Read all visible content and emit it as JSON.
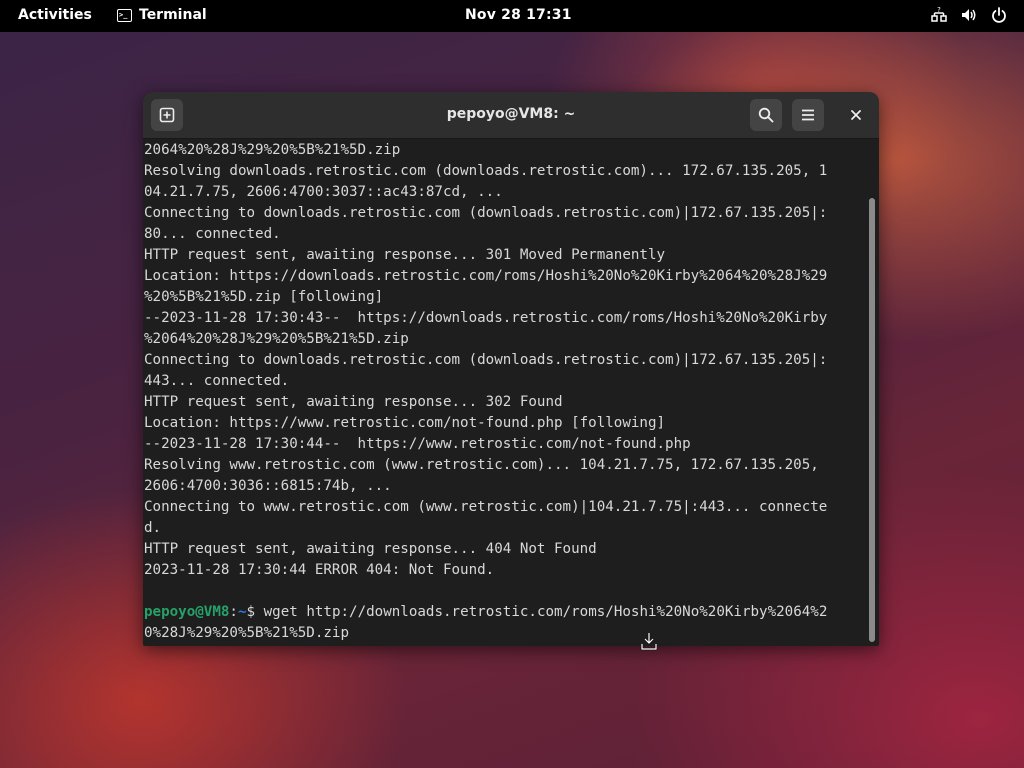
{
  "topbar": {
    "activities": "Activities",
    "app_name": "Terminal",
    "app_icon": "terminal-icon",
    "clock": "Nov 28  17:31",
    "system_icons": [
      "accessibility-icon",
      "volume-icon",
      "power-icon"
    ]
  },
  "window": {
    "title": "pepoyo@VM8: ~",
    "new_tab_icon": "new-tab-icon",
    "search_icon": "search-icon",
    "menu_icon": "hamburger-menu-icon",
    "close_icon": "close-icon"
  },
  "terminal": {
    "lines": [
      "2064%20%28J%29%20%5B%21%5D.zip",
      "Resolving downloads.retrostic.com (downloads.retrostic.com)... 172.67.135.205, 1",
      "04.21.7.75, 2606:4700:3037::ac43:87cd, ...",
      "Connecting to downloads.retrostic.com (downloads.retrostic.com)|172.67.135.205|:",
      "80... connected.",
      "HTTP request sent, awaiting response... 301 Moved Permanently",
      "Location: https://downloads.retrostic.com/roms/Hoshi%20No%20Kirby%2064%20%28J%29",
      "%20%5B%21%5D.zip [following]",
      "--2023-11-28 17:30:43--  https://downloads.retrostic.com/roms/Hoshi%20No%20Kirby",
      "%2064%20%28J%29%20%5B%21%5D.zip",
      "Connecting to downloads.retrostic.com (downloads.retrostic.com)|172.67.135.205|:",
      "443... connected.",
      "HTTP request sent, awaiting response... 302 Found",
      "Location: https://www.retrostic.com/not-found.php [following]",
      "--2023-11-28 17:30:44--  https://www.retrostic.com/not-found.php",
      "Resolving www.retrostic.com (www.retrostic.com)... 104.21.7.75, 172.67.135.205,",
      "2606:4700:3036::6815:74b, ...",
      "Connecting to www.retrostic.com (www.retrostic.com)|104.21.7.75|:443... connecte",
      "d.",
      "HTTP request sent, awaiting response... 404 Not Found",
      "2023-11-28 17:30:44 ERROR 404: Not Found.",
      ""
    ],
    "prompt_user": "pepoyo@VM8",
    "prompt_sep": ":",
    "prompt_path": "~",
    "prompt_symbol": "$ ",
    "command_line1": "wget http://downloads.retrostic.com/roms/Hoshi%20No%20Kirby%2064%2",
    "command_line2": "0%28J%29%20%5B%21%5D.zip"
  },
  "colors": {
    "prompt_user": "#26a269",
    "prompt_path": "#2a7bde",
    "terminal_bg": "#1e1e1e",
    "titlebar_bg": "#2e2e2e"
  }
}
